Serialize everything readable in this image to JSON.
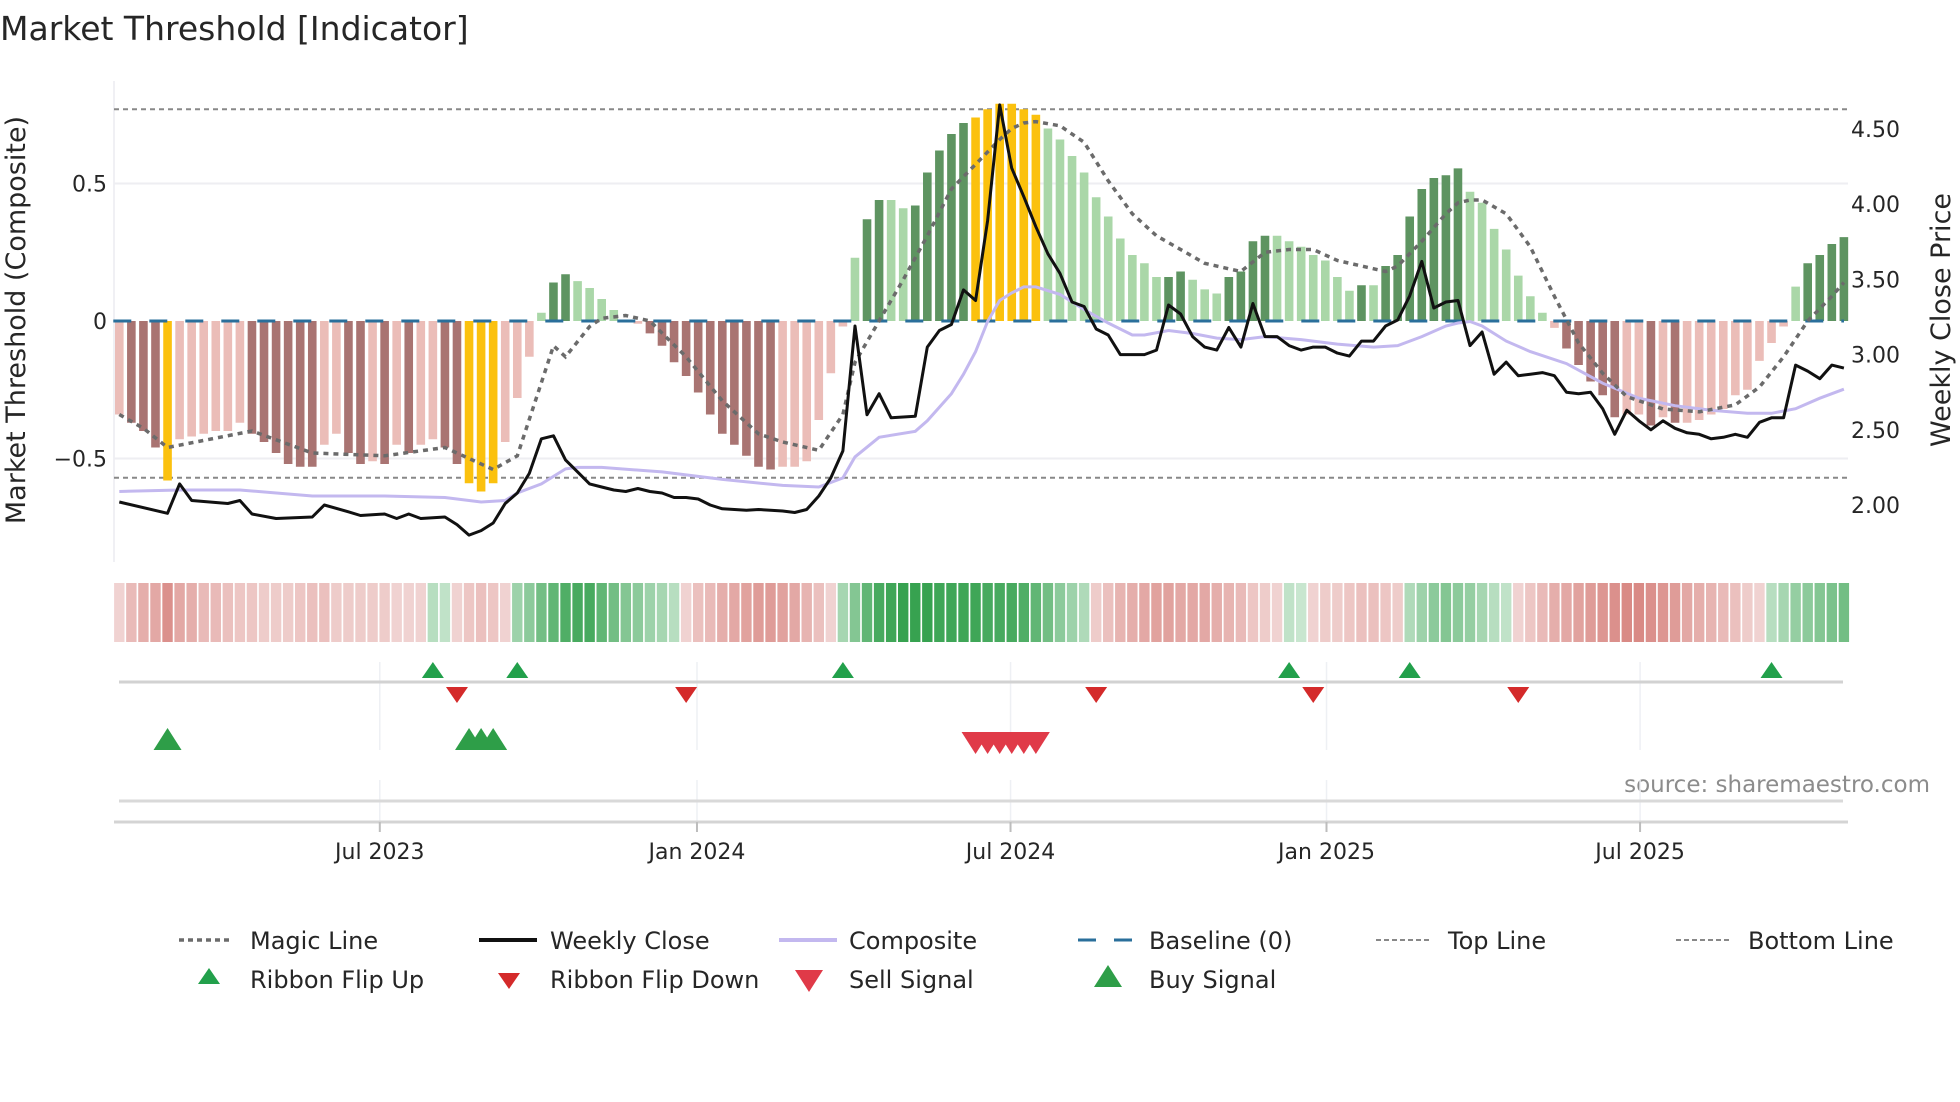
{
  "chart_data": {
    "type": "bar",
    "title": "Market Threshold [Indicator]",
    "ylabel_left": "Market Threshold (Composite)",
    "ylabel_right": "Weekly Close Price",
    "source": "source: sharemaestro.com",
    "y_left": {
      "range": [
        -0.88,
        0.88
      ],
      "ticks": [
        {
          "v": 0.5,
          "label": "0.5"
        },
        {
          "v": 0,
          "label": "0"
        },
        {
          "v": -0.5,
          "label": "−0.5"
        }
      ]
    },
    "y_right": {
      "range": [
        1.75,
        4.7
      ],
      "ticks": [
        {
          "v": 4.5,
          "label": "4.50"
        },
        {
          "v": 4.0,
          "label": "4.00"
        },
        {
          "v": 3.5,
          "label": "3.50"
        },
        {
          "v": 3.0,
          "label": "3.00"
        },
        {
          "v": 2.5,
          "label": "2.50"
        },
        {
          "v": 2.0,
          "label": "2.00"
        }
      ]
    },
    "x_unit": "week index",
    "x_ticks": [
      {
        "week": 21.6,
        "label": "Jul 2023"
      },
      {
        "week": 47.9,
        "label": "Jan 2024"
      },
      {
        "week": 73.9,
        "label": "Jul 2024"
      },
      {
        "week": 100.1,
        "label": "Jan 2025"
      },
      {
        "week": 126.1,
        "label": "Jul 2025"
      }
    ],
    "top_line": 0.77,
    "bottom_line": -0.57,
    "baseline": 0,
    "composite_bars": [
      -0.34,
      -0.37,
      -0.4,
      -0.46,
      -0.58,
      -0.43,
      -0.42,
      -0.41,
      -0.4,
      -0.4,
      -0.37,
      -0.41,
      -0.44,
      -0.48,
      -0.52,
      -0.53,
      -0.53,
      -0.45,
      -0.41,
      -0.48,
      -0.52,
      -0.51,
      -0.52,
      -0.45,
      -0.48,
      -0.45,
      -0.43,
      -0.46,
      -0.52,
      -0.59,
      -0.62,
      -0.59,
      -0.44,
      -0.28,
      -0.13,
      0.03,
      0.14,
      0.17,
      0.145,
      0.12,
      0.08,
      0.04,
      0.005,
      -0.01,
      -0.045,
      -0.09,
      -0.15,
      -0.2,
      -0.26,
      -0.34,
      -0.41,
      -0.45,
      -0.49,
      -0.53,
      -0.54,
      -0.53,
      -0.53,
      -0.51,
      -0.36,
      -0.19,
      -0.02,
      0.23,
      0.37,
      0.44,
      0.44,
      0.41,
      0.42,
      0.54,
      0.62,
      0.68,
      0.72,
      0.74,
      0.77,
      0.79,
      0.79,
      0.77,
      0.75,
      0.7,
      0.66,
      0.6,
      0.54,
      0.45,
      0.38,
      0.3,
      0.24,
      0.21,
      0.16,
      0.16,
      0.18,
      0.15,
      0.115,
      0.1,
      0.16,
      0.18,
      0.29,
      0.31,
      0.31,
      0.29,
      0.27,
      0.24,
      0.22,
      0.16,
      0.11,
      0.13,
      0.13,
      0.2,
      0.24,
      0.38,
      0.48,
      0.52,
      0.53,
      0.555,
      0.47,
      0.43,
      0.335,
      0.26,
      0.165,
      0.09,
      0.03,
      -0.025,
      -0.1,
      -0.16,
      -0.22,
      -0.27,
      -0.35,
      -0.34,
      -0.34,
      -0.38,
      -0.35,
      -0.37,
      -0.37,
      -0.36,
      -0.34,
      -0.32,
      -0.27,
      -0.25,
      -0.145,
      -0.08,
      -0.02,
      0.125,
      0.21,
      0.24,
      0.28,
      0.305
    ],
    "bar_style": [
      "l",
      "d",
      "d",
      "d",
      "y",
      "l",
      "l",
      "l",
      "l",
      "l",
      "l",
      "d",
      "d",
      "d",
      "d",
      "d",
      "d",
      "l",
      "l",
      "d",
      "d",
      "l",
      "d",
      "l",
      "d",
      "l",
      "l",
      "d",
      "d",
      "y",
      "y",
      "y",
      "l",
      "l",
      "l",
      "l",
      "d",
      "d",
      "l",
      "l",
      "l",
      "l",
      "l",
      "l",
      "d",
      "d",
      "d",
      "d",
      "d",
      "d",
      "d",
      "d",
      "d",
      "d",
      "d",
      "l",
      "l",
      "l",
      "l",
      "l",
      "l",
      "l",
      "d",
      "d",
      "l",
      "l",
      "d",
      "d",
      "d",
      "d",
      "d",
      "y",
      "y",
      "y",
      "y",
      "y",
      "y",
      "l",
      "l",
      "l",
      "l",
      "l",
      "l",
      "l",
      "l",
      "l",
      "l",
      "d",
      "d",
      "l",
      "l",
      "l",
      "d",
      "d",
      "d",
      "d",
      "l",
      "l",
      "l",
      "l",
      "l",
      "l",
      "l",
      "d",
      "l",
      "d",
      "d",
      "d",
      "d",
      "d",
      "d",
      "d",
      "l",
      "l",
      "l",
      "l",
      "l",
      "l",
      "l",
      "l",
      "d",
      "d",
      "d",
      "d",
      "d",
      "l",
      "l",
      "d",
      "l",
      "d",
      "l",
      "l",
      "l",
      "l",
      "l",
      "l",
      "l",
      "l",
      "l",
      "l",
      "d",
      "d",
      "d",
      "d"
    ],
    "ribbon": [
      -0.15,
      -0.35,
      -0.45,
      -0.5,
      -0.7,
      -0.5,
      -0.45,
      -0.35,
      -0.35,
      -0.3,
      -0.25,
      -0.25,
      -0.2,
      -0.2,
      -0.2,
      -0.25,
      -0.3,
      -0.3,
      -0.2,
      -0.2,
      -0.2,
      -0.2,
      -0.2,
      -0.15,
      -0.15,
      -0.15,
      0.2,
      0.15,
      -0.15,
      -0.25,
      -0.3,
      -0.25,
      -0.15,
      0.35,
      0.45,
      0.6,
      0.7,
      0.8,
      0.85,
      0.85,
      0.7,
      0.6,
      0.5,
      0.45,
      0.35,
      0.3,
      0.2,
      -0.15,
      -0.3,
      -0.35,
      -0.45,
      -0.5,
      -0.55,
      -0.6,
      -0.6,
      -0.55,
      -0.5,
      -0.4,
      -0.3,
      -0.15,
      0.3,
      0.5,
      0.7,
      0.85,
      0.9,
      0.95,
      0.95,
      0.95,
      0.9,
      0.9,
      0.9,
      0.9,
      0.85,
      0.85,
      0.85,
      0.8,
      0.7,
      0.6,
      0.45,
      0.35,
      0.25,
      -0.2,
      -0.3,
      -0.4,
      -0.45,
      -0.5,
      -0.55,
      -0.55,
      -0.5,
      -0.5,
      -0.5,
      -0.45,
      -0.4,
      -0.35,
      -0.25,
      -0.2,
      -0.15,
      0.15,
      0.1,
      -0.15,
      -0.2,
      -0.2,
      -0.25,
      -0.3,
      -0.3,
      -0.25,
      -0.2,
      0.25,
      0.35,
      0.45,
      0.5,
      0.45,
      0.4,
      0.3,
      0.2,
      0.15,
      -0.15,
      -0.25,
      -0.35,
      -0.45,
      -0.5,
      -0.55,
      -0.6,
      -0.65,
      -0.7,
      -0.75,
      -0.75,
      -0.7,
      -0.65,
      -0.6,
      -0.5,
      -0.45,
      -0.4,
      -0.35,
      -0.3,
      -0.2,
      -0.15,
      0.2,
      0.3,
      0.4,
      0.45,
      0.5,
      0.55,
      0.6
    ],
    "magic_line": [
      [
        0,
        -0.34
      ],
      [
        2,
        -0.39
      ],
      [
        4,
        -0.46
      ],
      [
        11,
        -0.4
      ],
      [
        16,
        -0.48
      ],
      [
        22,
        -0.49
      ],
      [
        27,
        -0.46
      ],
      [
        31,
        -0.54
      ],
      [
        33,
        -0.49
      ],
      [
        36,
        -0.09
      ],
      [
        37,
        -0.13
      ],
      [
        39,
        -0.02
      ],
      [
        40,
        0.01
      ],
      [
        42,
        0.02
      ],
      [
        44,
        0.0
      ],
      [
        47,
        -0.13
      ],
      [
        50,
        -0.29
      ],
      [
        53,
        -0.41
      ],
      [
        55,
        -0.44
      ],
      [
        58,
        -0.47
      ],
      [
        60,
        -0.34
      ],
      [
        61,
        -0.15
      ],
      [
        63,
        0.0
      ],
      [
        65,
        0.15
      ],
      [
        67,
        0.31
      ],
      [
        69,
        0.48
      ],
      [
        71,
        0.57
      ],
      [
        73,
        0.66
      ],
      [
        74,
        0.7
      ],
      [
        75,
        0.72
      ],
      [
        76,
        0.725
      ],
      [
        78,
        0.71
      ],
      [
        80,
        0.65
      ],
      [
        82,
        0.51
      ],
      [
        84,
        0.39
      ],
      [
        86,
        0.31
      ],
      [
        88,
        0.26
      ],
      [
        90,
        0.21
      ],
      [
        92,
        0.19
      ],
      [
        93,
        0.18
      ],
      [
        95,
        0.25
      ],
      [
        97,
        0.26
      ],
      [
        99,
        0.26
      ],
      [
        101,
        0.22
      ],
      [
        103,
        0.2
      ],
      [
        105,
        0.18
      ],
      [
        106,
        0.2
      ],
      [
        108,
        0.29
      ],
      [
        110,
        0.39
      ],
      [
        111,
        0.43
      ],
      [
        112,
        0.44
      ],
      [
        113,
        0.44
      ],
      [
        115,
        0.39
      ],
      [
        117,
        0.27
      ],
      [
        119,
        0.09
      ],
      [
        121,
        -0.08
      ],
      [
        123,
        -0.19
      ],
      [
        125,
        -0.275
      ],
      [
        128,
        -0.32
      ],
      [
        131,
        -0.33
      ],
      [
        134,
        -0.305
      ],
      [
        136,
        -0.24
      ],
      [
        138,
        -0.13
      ],
      [
        140,
        0.0
      ],
      [
        142,
        0.09
      ],
      [
        143,
        0.14
      ]
    ],
    "weekly_close": [
      [
        0,
        2.02
      ],
      [
        4,
        1.945
      ],
      [
        5,
        2.14
      ],
      [
        6,
        2.03
      ],
      [
        9,
        2.01
      ],
      [
        10,
        2.03
      ],
      [
        11,
        1.94
      ],
      [
        13,
        1.91
      ],
      [
        16,
        1.92
      ],
      [
        17,
        2.0
      ],
      [
        19,
        1.955
      ],
      [
        20,
        1.93
      ],
      [
        22,
        1.94
      ],
      [
        23,
        1.91
      ],
      [
        24,
        1.94
      ],
      [
        25,
        1.91
      ],
      [
        27,
        1.92
      ],
      [
        28,
        1.87
      ],
      [
        29,
        1.8
      ],
      [
        30,
        1.83
      ],
      [
        31,
        1.88
      ],
      [
        32,
        2.01
      ],
      [
        33,
        2.08
      ],
      [
        34,
        2.21
      ],
      [
        35,
        2.44
      ],
      [
        36,
        2.46
      ],
      [
        37,
        2.3
      ],
      [
        38,
        2.22
      ],
      [
        39,
        2.14
      ],
      [
        40,
        2.12
      ],
      [
        41,
        2.1
      ],
      [
        42,
        2.09
      ],
      [
        43,
        2.11
      ],
      [
        44,
        2.09
      ],
      [
        45,
        2.08
      ],
      [
        46,
        2.05
      ],
      [
        47,
        2.05
      ],
      [
        48,
        2.04
      ],
      [
        49,
        2.0
      ],
      [
        50,
        1.975
      ],
      [
        51,
        1.97
      ],
      [
        52,
        1.965
      ],
      [
        53,
        1.97
      ],
      [
        54,
        1.965
      ],
      [
        55,
        1.96
      ],
      [
        56,
        1.95
      ],
      [
        57,
        1.97
      ],
      [
        58,
        2.06
      ],
      [
        59,
        2.18
      ],
      [
        60,
        2.36
      ],
      [
        61,
        3.19
      ],
      [
        62,
        2.6
      ],
      [
        63,
        2.74
      ],
      [
        64,
        2.58
      ],
      [
        65,
        2.585
      ],
      [
        66,
        2.59
      ],
      [
        67,
        3.05
      ],
      [
        68,
        3.16
      ],
      [
        69,
        3.2
      ],
      [
        70,
        3.43
      ],
      [
        71,
        3.36
      ],
      [
        72,
        3.89
      ],
      [
        73,
        4.66
      ],
      [
        74,
        4.24
      ],
      [
        75,
        4.05
      ],
      [
        76,
        3.85
      ],
      [
        77,
        3.67
      ],
      [
        78,
        3.54
      ],
      [
        79,
        3.35
      ],
      [
        80,
        3.32
      ],
      [
        81,
        3.17
      ],
      [
        82,
        3.13
      ],
      [
        83,
        3.0
      ],
      [
        84,
        3.0
      ],
      [
        85,
        3.0
      ],
      [
        86,
        3.03
      ],
      [
        87,
        3.33
      ],
      [
        88,
        3.27
      ],
      [
        89,
        3.12
      ],
      [
        90,
        3.05
      ],
      [
        91,
        3.03
      ],
      [
        92,
        3.18
      ],
      [
        93,
        3.05
      ],
      [
        94,
        3.34
      ],
      [
        95,
        3.12
      ],
      [
        96,
        3.12
      ],
      [
        97,
        3.06
      ],
      [
        98,
        3.03
      ],
      [
        99,
        3.05
      ],
      [
        100,
        3.05
      ],
      [
        101,
        3.01
      ],
      [
        102,
        2.99
      ],
      [
        103,
        3.09
      ],
      [
        104,
        3.09
      ],
      [
        105,
        3.19
      ],
      [
        106,
        3.23
      ],
      [
        107,
        3.39
      ],
      [
        108,
        3.62
      ],
      [
        109,
        3.31
      ],
      [
        110,
        3.35
      ],
      [
        111,
        3.36
      ],
      [
        112,
        3.06
      ],
      [
        113,
        3.15
      ],
      [
        114,
        2.87
      ],
      [
        115,
        2.95
      ],
      [
        116,
        2.86
      ],
      [
        117,
        2.87
      ],
      [
        118,
        2.88
      ],
      [
        119,
        2.86
      ],
      [
        120,
        2.75
      ],
      [
        121,
        2.74
      ],
      [
        122,
        2.75
      ],
      [
        123,
        2.64
      ],
      [
        124,
        2.47
      ],
      [
        125,
        2.63
      ],
      [
        126,
        2.56
      ],
      [
        127,
        2.5
      ],
      [
        128,
        2.56
      ],
      [
        129,
        2.51
      ],
      [
        130,
        2.48
      ],
      [
        131,
        2.47
      ],
      [
        132,
        2.44
      ],
      [
        133,
        2.45
      ],
      [
        134,
        2.47
      ],
      [
        135,
        2.45
      ],
      [
        136,
        2.55
      ],
      [
        137,
        2.58
      ],
      [
        138,
        2.58
      ],
      [
        139,
        2.93
      ],
      [
        140,
        2.89
      ],
      [
        141,
        2.84
      ],
      [
        142,
        2.93
      ],
      [
        143,
        2.91
      ]
    ],
    "composite_line": [
      [
        0,
        2.09
      ],
      [
        5,
        2.1
      ],
      [
        10,
        2.1
      ],
      [
        16,
        2.06
      ],
      [
        22,
        2.06
      ],
      [
        27,
        2.05
      ],
      [
        30,
        2.02
      ],
      [
        32,
        2.03
      ],
      [
        33,
        2.08
      ],
      [
        35,
        2.14
      ],
      [
        37,
        2.24
      ],
      [
        38,
        2.25
      ],
      [
        40,
        2.25
      ],
      [
        45,
        2.22
      ],
      [
        50,
        2.17
      ],
      [
        55,
        2.13
      ],
      [
        58,
        2.12
      ],
      [
        60,
        2.18
      ],
      [
        61,
        2.32
      ],
      [
        63,
        2.45
      ],
      [
        66,
        2.49
      ],
      [
        67,
        2.56
      ],
      [
        69,
        2.74
      ],
      [
        70,
        2.87
      ],
      [
        71,
        3.02
      ],
      [
        72,
        3.22
      ],
      [
        73,
        3.36
      ],
      [
        74,
        3.41
      ],
      [
        75,
        3.45
      ],
      [
        76,
        3.45
      ],
      [
        78,
        3.4
      ],
      [
        80,
        3.3
      ],
      [
        82,
        3.21
      ],
      [
        84,
        3.13
      ],
      [
        85,
        3.13
      ],
      [
        87,
        3.16
      ],
      [
        89,
        3.14
      ],
      [
        91,
        3.11
      ],
      [
        93,
        3.1
      ],
      [
        95,
        3.12
      ],
      [
        98,
        3.1
      ],
      [
        101,
        3.07
      ],
      [
        104,
        3.05
      ],
      [
        106,
        3.06
      ],
      [
        108,
        3.12
      ],
      [
        110,
        3.19
      ],
      [
        111,
        3.21
      ],
      [
        112,
        3.22
      ],
      [
        113,
        3.19
      ],
      [
        115,
        3.09
      ],
      [
        117,
        3.02
      ],
      [
        120,
        2.94
      ],
      [
        123,
        2.81
      ],
      [
        126,
        2.71
      ],
      [
        129,
        2.66
      ],
      [
        132,
        2.63
      ],
      [
        135,
        2.61
      ],
      [
        137,
        2.61
      ],
      [
        139,
        2.64
      ],
      [
        141,
        2.71
      ],
      [
        143,
        2.77
      ]
    ],
    "ribbon_flip_up": [
      26,
      33,
      60,
      97,
      107,
      137
    ],
    "ribbon_flip_down": [
      28,
      47,
      81,
      99,
      116
    ],
    "buy_signal": [
      4,
      29,
      30,
      31
    ],
    "sell_signal": [
      71,
      72,
      73,
      74,
      75,
      76
    ],
    "legend": {
      "placement": "bottom",
      "entries": [
        {
          "key": "magic",
          "label": "Magic Line"
        },
        {
          "key": "close",
          "label": "Weekly Close"
        },
        {
          "key": "composite",
          "label": "Composite"
        },
        {
          "key": "baseline",
          "label": "Baseline (0)"
        },
        {
          "key": "top",
          "label": "Top Line"
        },
        {
          "key": "bottom",
          "label": "Bottom Line"
        },
        {
          "key": "flipup",
          "label": "Ribbon Flip Up"
        },
        {
          "key": "flipdown",
          "label": "Ribbon Flip Down"
        },
        {
          "key": "sell",
          "label": "Sell Signal"
        },
        {
          "key": "buy",
          "label": "Buy Signal"
        }
      ]
    },
    "colors": {
      "pos_dark": "#5e9461",
      "pos_light": "#aad7a8",
      "neg_dark": "#a97472",
      "neg_light": "#ebbdb8",
      "extreme": "#fbc10e",
      "magic": "#6b6b6b",
      "close": "#111111",
      "composite": "#c3b8ef",
      "baseline": "#2a6f9b",
      "guide": "#888888",
      "ribbon_pos": "#2e9e48",
      "ribbon_neg": "#cf6c66",
      "flip_up": "#22a04b",
      "flip_down": "#d42a2a",
      "buy": "#2e9e48",
      "sell": "#e03a48"
    }
  }
}
